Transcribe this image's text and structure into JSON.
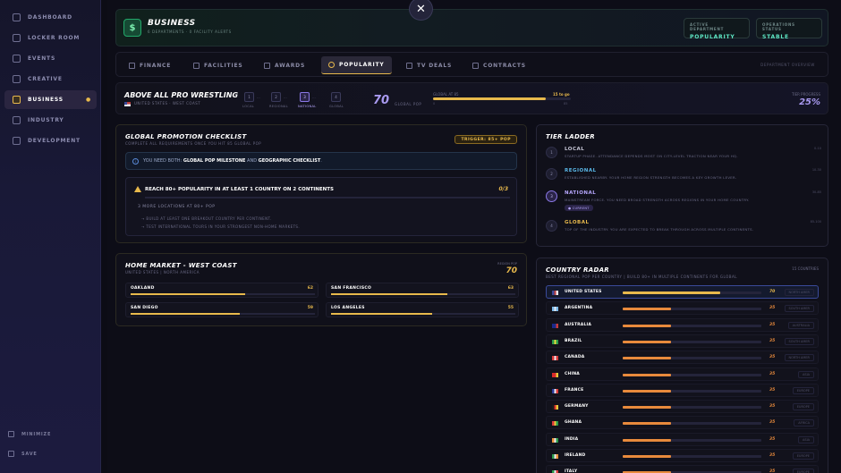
{
  "sidebar": {
    "items": [
      {
        "label": "DASHBOARD",
        "icon": "home-icon"
      },
      {
        "label": "LOCKER ROOM",
        "icon": "people-icon"
      },
      {
        "label": "EVENTS",
        "icon": "calendar-icon"
      },
      {
        "label": "CREATIVE",
        "icon": "pen-icon"
      },
      {
        "label": "BUSINESS",
        "icon": "briefcase-icon",
        "active": true
      },
      {
        "label": "INDUSTRY",
        "icon": "globe-icon"
      },
      {
        "label": "DEVELOPMENT",
        "icon": "gear-icon"
      }
    ],
    "active_dot": "●",
    "minimize_label": "MINIMIZE",
    "save_label": "SAVE"
  },
  "close_glyph": "✕",
  "header": {
    "icon_glyph": "$",
    "title": "BUSINESS",
    "subtitle": "6 DEPARTMENTS · 0 FACILITY ALERTS",
    "active_dept_label": "ACTIVE DEPARTMENT",
    "active_dept_value": "POPULARITY",
    "ops_status_label": "OPERATIONS STATUS",
    "ops_status_value": "STABLE"
  },
  "tabs": [
    {
      "label": "FINANCE",
      "icon": "dollar-icon"
    },
    {
      "label": "FACILITIES",
      "icon": "building-icon"
    },
    {
      "label": "AWARDS",
      "icon": "trophy-icon"
    },
    {
      "label": "POPULARITY",
      "icon": "star-icon",
      "active": true
    },
    {
      "label": "TV DEALS",
      "icon": "tv-icon"
    },
    {
      "label": "CONTRACTS",
      "icon": "contract-icon"
    }
  ],
  "dept_overview_label": "DEPARTMENT OVERVIEW",
  "promotion": {
    "name": "ABOVE ALL PRO WRESTLING",
    "region": "UNITED STATES · WEST COAST",
    "tier_steps": [
      {
        "label": "LOCAL",
        "num": "1"
      },
      {
        "label": "REGIONAL",
        "num": "2"
      },
      {
        "label": "NATIONAL",
        "num": "3",
        "current": true
      },
      {
        "label": "GLOBAL",
        "num": "4"
      }
    ],
    "dots": "···",
    "global_pop_value": "70",
    "global_pop_label": "GLOBAL POP",
    "global_at_label": "GLOBAL AT 85",
    "to_go": "15 to go",
    "progress_fraction": 0.82,
    "bar_min": "0",
    "bar_max": "85",
    "tier_progress_label": "TIER PROGRESS",
    "tier_progress_value": "25%"
  },
  "checklist": {
    "title": "GLOBAL PROMOTION CHECKLIST",
    "subtitle": "COMPLETE ALL REQUIREMENTS ONCE YOU HIT 85 GLOBAL POP",
    "trigger": "TRIGGER: 85+ POP",
    "info_pre": "YOU NEED BOTH:",
    "info_b1": "GLOBAL POP MILESTONE",
    "info_and": "AND",
    "info_b2": "GEOGRAPHIC CHECKLIST",
    "info_end": ".",
    "req_title": "REACH 80+ POPULARITY IN AT LEAST 1 COUNTRY ON 2 CONTINENTS",
    "req_count": "0/3",
    "req_more": "3 MORE LOCATIONS AT 80+ POP",
    "tips": [
      "→ BUILD AT LEAST ONE BREAKOUT COUNTRY PER CONTINENT.",
      "→ TEST INTERNATIONAL TOURS IN YOUR STRONGEST NON-HOME MARKETS."
    ]
  },
  "ladder": {
    "title": "TIER LADDER",
    "tiers": [
      {
        "name": "LOCAL",
        "num": "1",
        "desc": "STARTUP PHASE. ATTENDANCE DEPENDS MOST ON CITY-LEVEL TRACTION NEAR YOUR HQ.",
        "range": "0-10",
        "color": "#c8c8d8"
      },
      {
        "name": "REGIONAL",
        "num": "2",
        "desc": "ESTABLISHED NEARBY. YOUR HOME REGION STRENGTH BECOMES A KEY GROWTH LEVER.",
        "range": "10-30",
        "color": "#5ab8e8"
      },
      {
        "name": "NATIONAL",
        "num": "3",
        "desc": "MAINSTREAM FORCE. YOU NEED BROAD STRENGTH ACROSS REGIONS IN YOUR HOME COUNTRY.",
        "range": "30-85",
        "color": "#b8a8ff"
      },
      {
        "name": "GLOBAL",
        "num": "4",
        "desc": "TOP OF THE INDUSTRY. YOU ARE EXPECTED TO BREAK THROUGH ACROSS MULTIPLE CONTINENTS.",
        "range": "85-100",
        "color": "#e8b94c"
      }
    ],
    "current_badge": "● CURRENT"
  },
  "home": {
    "title": "HOME MARKET - WEST COAST",
    "subtitle": "UNITED STATES | NORTH AMERICA",
    "pop_label": "REGION POP",
    "pop_value": "70",
    "cities": [
      {
        "name": "OAKLAND",
        "value": "62",
        "fraction": 0.62
      },
      {
        "name": "SAN FRANCISCO",
        "value": "63",
        "fraction": 0.63
      },
      {
        "name": "SAN DIEGO",
        "value": "59",
        "fraction": 0.59
      },
      {
        "name": "LOS ANGELES",
        "value": "55",
        "fraction": 0.55
      }
    ]
  },
  "radar": {
    "title": "COUNTRY RADAR",
    "subtitle": "BEST REGIONAL POP PER COUNTRY | BUILD 80+ IN MULTIPLE CONTINENTS FOR GLOBAL",
    "count": "15 COUNTRIES",
    "countries": [
      {
        "name": "UNITED STATES",
        "value": "70",
        "fraction": 0.7,
        "region": "NORTH AMER",
        "top": true,
        "flag": [
          "#3a4a9a",
          "#b83a3a",
          "#e8e8f0"
        ]
      },
      {
        "name": "ARGENTINA",
        "value": "35",
        "fraction": 0.35,
        "region": "SOUTH AMER",
        "flag": [
          "#7ab8e8",
          "#e8e8f0",
          "#7ab8e8"
        ]
      },
      {
        "name": "AUSTRALIA",
        "value": "35",
        "fraction": 0.35,
        "region": "AUSTRALIA",
        "flag": [
          "#1a2a8a",
          "#1a2a8a",
          "#c83a3a"
        ]
      },
      {
        "name": "BRAZIL",
        "value": "35",
        "fraction": 0.35,
        "region": "SOUTH AMER",
        "flag": [
          "#2a9a4a",
          "#e8d83a",
          "#2a9a4a"
        ]
      },
      {
        "name": "CANADA",
        "value": "35",
        "fraction": 0.35,
        "region": "NORTH AMER",
        "flag": [
          "#d83a3a",
          "#e8e8f0",
          "#d83a3a"
        ]
      },
      {
        "name": "CHINA",
        "value": "35",
        "fraction": 0.35,
        "region": "ASIA",
        "flag": [
          "#d82a2a",
          "#d82a2a",
          "#e8c83a"
        ]
      },
      {
        "name": "FRANCE",
        "value": "35",
        "fraction": 0.35,
        "region": "EUROPE",
        "flag": [
          "#2a3a9a",
          "#e8e8f0",
          "#d83a3a"
        ]
      },
      {
        "name": "GERMANY",
        "value": "35",
        "fraction": 0.35,
        "region": "EUROPE",
        "flag": [
          "#1a1a1a",
          "#d82a2a",
          "#e8c83a"
        ]
      },
      {
        "name": "GHANA",
        "value": "35",
        "fraction": 0.35,
        "region": "AFRICA",
        "flag": [
          "#d83a3a",
          "#e8c83a",
          "#2a9a4a"
        ]
      },
      {
        "name": "INDIA",
        "value": "35",
        "fraction": 0.35,
        "region": "ASIA",
        "flag": [
          "#e8903a",
          "#e8e8f0",
          "#2a9a4a"
        ]
      },
      {
        "name": "IRELAND",
        "value": "35",
        "fraction": 0.35,
        "region": "EUROPE",
        "flag": [
          "#2a9a4a",
          "#e8e8f0",
          "#e8903a"
        ]
      },
      {
        "name": "ITALY",
        "value": "35",
        "fraction": 0.35,
        "region": "EUROPE",
        "flag": [
          "#2a9a4a",
          "#e8e8f0",
          "#d83a3a"
        ]
      }
    ]
  }
}
